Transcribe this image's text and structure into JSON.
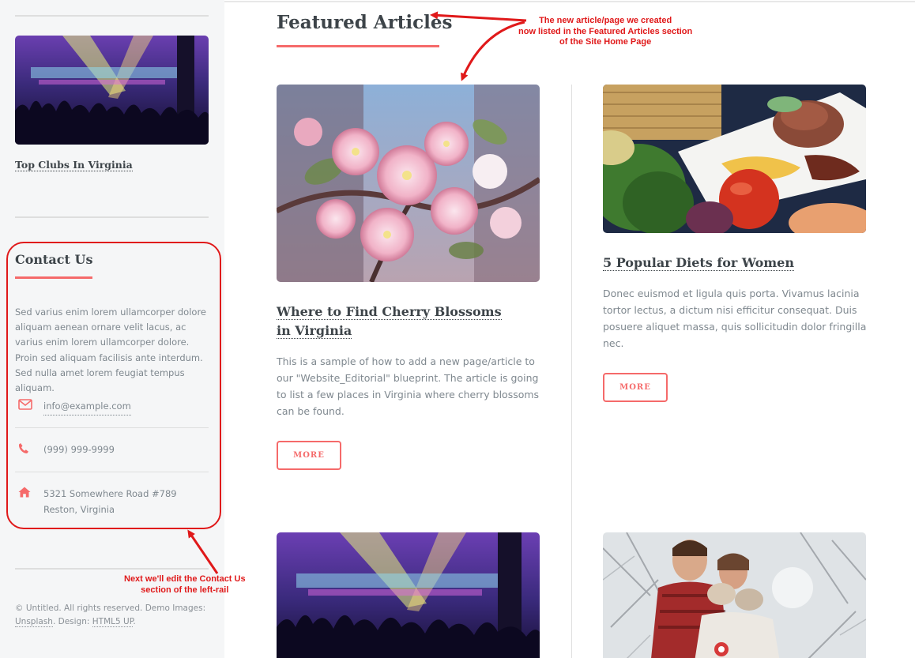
{
  "sidebar": {
    "clubs_link": "Top Clubs In Virginia",
    "contact": {
      "title": "Contact Us",
      "text": "Sed varius enim lorem ullamcorper dolore aliquam aenean ornare velit lacus, ac varius enim lorem ullamcorper dolore. Proin sed aliquam facilisis ante interdum. Sed nulla amet lorem feugiat tempus aliquam.",
      "email": "info@example.com",
      "phone": "(999) 999-9999",
      "address_line1": "5321 Somewhere Road #789",
      "address_line2": "Reston, Virginia"
    },
    "footer": {
      "copyright_prefix": "© Untitled. All rights reserved. Demo Images:",
      "unsplash": "Unsplash",
      "design_prefix": ". Design:",
      "html5up": "HTML5 UP",
      "period": "."
    }
  },
  "main": {
    "section_title": "Featured Articles",
    "articles": [
      {
        "title": "Where to Find Cherry Blossoms in Virginia",
        "text": "This is a sample of how to add a new page/article to our \"Website_Editorial\" blueprint. The article is going to list a few places in Virginia where cherry blossoms can be found.",
        "button": "MORE"
      },
      {
        "title": "5 Popular Diets for Women",
        "text": "Donec euismod et ligula quis porta. Vivamus lacinia tortor lectus, a dictum nisi efficitur consequat. Duis posuere aliquet massa, quis sollicitudin dolor fringilla nec.",
        "button": "MORE"
      }
    ]
  },
  "annotations": {
    "featured_note": [
      "The new article/page we created",
      "now listed in the Featured Articles section",
      "of the Site Home Page"
    ],
    "contact_note": [
      "Next we'll edit the Contact Us",
      "section of the left-rail"
    ]
  },
  "colors": {
    "accent": "#f56a6a",
    "annotation": "#e0191a",
    "heading": "#3d4449",
    "body_text": "#7f888f",
    "sidebar_bg": "#f5f6f7"
  },
  "icons": [
    "envelope-icon",
    "phone-icon",
    "home-icon"
  ]
}
